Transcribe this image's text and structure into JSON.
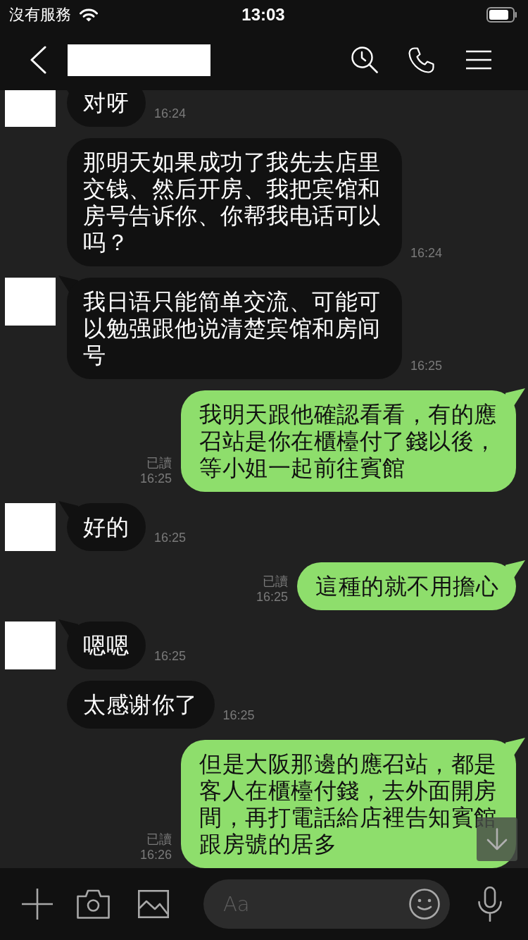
{
  "status_bar": {
    "carrier": "沒有服務",
    "time": "13:03"
  },
  "messages": [
    {
      "kind": "incoming",
      "avatar": true,
      "text": "对呀",
      "time": "16:24"
    },
    {
      "kind": "incoming",
      "avatar": false,
      "text": "那明天如果成功了我先去店里交钱、然后开房、我把宾馆和房号告诉你、你帮我电话可以吗？",
      "time": "16:24"
    },
    {
      "kind": "incoming",
      "avatar": true,
      "text": "我日语只能简单交流、可能可以勉强跟他说清楚宾馆和房间号",
      "time": "16:25"
    },
    {
      "kind": "outgoing",
      "avatar": false,
      "text": "我明天跟他確認看看，有的應召站是你在櫃檯付了錢以後，等小姐一起前往賓館",
      "read_label": "已讀",
      "time": "16:25"
    },
    {
      "kind": "incoming",
      "avatar": true,
      "text": "好的",
      "time": "16:25"
    },
    {
      "kind": "outgoing",
      "avatar": false,
      "text": "這種的就不用擔心",
      "read_label": "已讀",
      "time": "16:25"
    },
    {
      "kind": "incoming",
      "avatar": true,
      "text": "嗯嗯",
      "time": "16:25"
    },
    {
      "kind": "incoming",
      "avatar": false,
      "text": "太感谢你了",
      "time": "16:25"
    },
    {
      "kind": "outgoing",
      "avatar": false,
      "text": "但是大阪那邊的應召站，都是客人在櫃檯付錢，去外面開房間，再打電話給店裡告知賓館跟房號的居多",
      "read_label": "已讀",
      "time": "16:26"
    }
  ],
  "composer": {
    "placeholder": "Aa"
  }
}
